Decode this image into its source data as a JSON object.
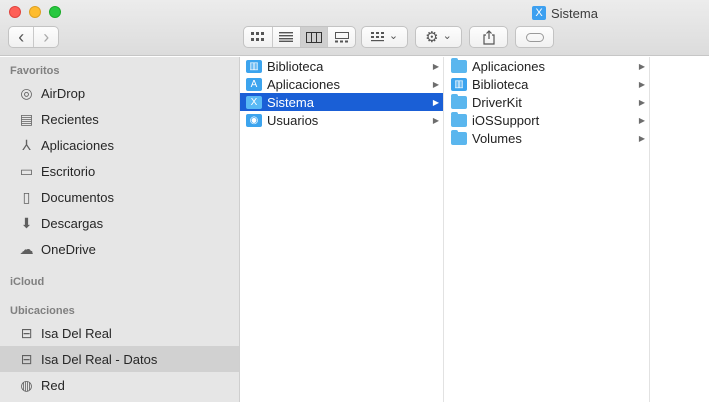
{
  "window": {
    "title": "Sistema"
  },
  "toolbar": {
    "back_glyph": "‹",
    "forward_glyph": "›",
    "view_icons": [
      "icon-view-icon",
      "list-view-icon",
      "column-view-icon",
      "gallery-view-icon"
    ],
    "group_glyph": "⌄",
    "action_glyph": "⚙",
    "share_glyph": "⇪"
  },
  "sidebar": {
    "favorites_header": "Favoritos",
    "favorites": [
      {
        "label": "AirDrop",
        "icon": "airdrop-icon",
        "glyph": "◎"
      },
      {
        "label": "Recientes",
        "icon": "recents-icon",
        "glyph": "▤"
      },
      {
        "label": "Aplicaciones",
        "icon": "applications-icon",
        "glyph": "⅄"
      },
      {
        "label": "Escritorio",
        "icon": "desktop-icon",
        "glyph": "▭"
      },
      {
        "label": "Documentos",
        "icon": "documents-icon",
        "glyph": "▯"
      },
      {
        "label": "Descargas",
        "icon": "downloads-icon",
        "glyph": "⬇"
      },
      {
        "label": "OneDrive",
        "icon": "cloud-icon",
        "glyph": "☁"
      }
    ],
    "icloud_header": "iCloud",
    "locations_header": "Ubicaciones",
    "locations": [
      {
        "label": "Isa Del Real",
        "icon": "disk-icon",
        "glyph": "⊟"
      },
      {
        "label": "Isa Del Real - Datos",
        "icon": "disk-icon",
        "glyph": "⊟"
      },
      {
        "label": "Red",
        "icon": "network-icon",
        "glyph": "◍"
      }
    ]
  },
  "columns": {
    "col1": [
      {
        "label": "Biblioteca",
        "icon": "library-icon",
        "glyph": "▥"
      },
      {
        "label": "Aplicaciones",
        "icon": "applications-icon",
        "glyph": "A"
      },
      {
        "label": "Sistema",
        "icon": "system-icon",
        "glyph": "X",
        "selected": true
      },
      {
        "label": "Usuarios",
        "icon": "users-icon",
        "glyph": "◉"
      }
    ],
    "col2": [
      {
        "label": "Aplicaciones",
        "icon": "folder-icon"
      },
      {
        "label": "Biblioteca",
        "icon": "library-icon",
        "glyph": "▥"
      },
      {
        "label": "DriverKit",
        "icon": "folder-icon"
      },
      {
        "label": "iOSSupport",
        "icon": "folder-icon"
      },
      {
        "label": "Volumes",
        "icon": "folder-icon"
      }
    ],
    "chevron": "▶"
  }
}
